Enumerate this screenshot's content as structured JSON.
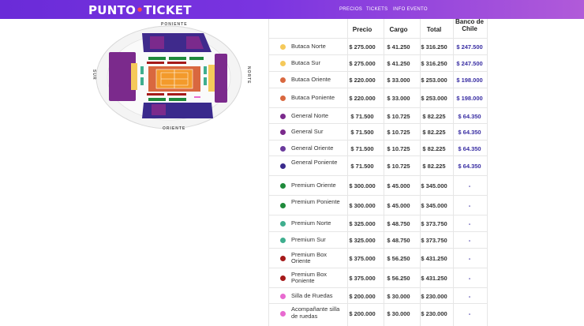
{
  "header": {
    "logo_text": "PUNTO",
    "logo_mark": "•",
    "logo_text2": "TICKET",
    "nav": [
      "PRECIOS",
      "TICKETS",
      "INFO EVENTO"
    ]
  },
  "map": {
    "label_top": "PONIENTE",
    "label_bottom": "ORIENTE",
    "label_left": "SUR",
    "label_right": "NORTE"
  },
  "table": {
    "columns": [
      "Precio",
      "Cargo",
      "Total",
      "Banco de Chile"
    ],
    "rows": [
      {
        "name": "Butaca Norte",
        "color": "#f5c95a",
        "precio": "$ 275.000",
        "cargo": "$ 41.250",
        "total": "$ 316.250",
        "banco": "$ 247.500"
      },
      {
        "name": "Butaca Sur",
        "color": "#f5c95a",
        "precio": "$ 275.000",
        "cargo": "$ 41.250",
        "total": "$ 316.250",
        "banco": "$ 247.500"
      },
      {
        "name": "Butaca Oriente",
        "color": "#d9683f",
        "precio": "$ 220.000",
        "cargo": "$ 33.000",
        "total": "$ 253.000",
        "banco": "$ 198.000"
      },
      {
        "name": "Butaca Poniente",
        "color": "#d9683f",
        "precio": "$ 220.000",
        "cargo": "$ 33.000",
        "total": "$ 253.000",
        "banco": "$ 198.000"
      },
      {
        "name": "General Norte",
        "color": "#7b2a8c",
        "precio": "$ 71.500",
        "cargo": "$ 10.725",
        "total": "$ 82.225",
        "banco": "$ 64.350"
      },
      {
        "name": "General Sur",
        "color": "#7b2a8c",
        "precio": "$ 71.500",
        "cargo": "$ 10.725",
        "total": "$ 82.225",
        "banco": "$ 64.350"
      },
      {
        "name": "General Oriente",
        "color": "#6a3a9c",
        "precio": "$ 71.500",
        "cargo": "$ 10.725",
        "total": "$ 82.225",
        "banco": "$ 64.350"
      },
      {
        "name": "General Poniente",
        "color": "#3a2a8c",
        "precio": "$ 71.500",
        "cargo": "$ 10.725",
        "total": "$ 82.225",
        "banco": "$ 64.350"
      },
      {
        "name": "Premium Oriente",
        "color": "#1f8a3b",
        "precio": "$ 300.000",
        "cargo": "$ 45.000",
        "total": "$ 345.000",
        "banco": "-"
      },
      {
        "name": "Premium Poniente",
        "color": "#1f8a3b",
        "precio": "$ 300.000",
        "cargo": "$ 45.000",
        "total": "$ 345.000",
        "banco": "-"
      },
      {
        "name": "Premium Norte",
        "color": "#3fae8e",
        "precio": "$ 325.000",
        "cargo": "$ 48.750",
        "total": "$ 373.750",
        "banco": "-"
      },
      {
        "name": "Premium Sur",
        "color": "#3fae8e",
        "precio": "$ 325.000",
        "cargo": "$ 48.750",
        "total": "$ 373.750",
        "banco": "-"
      },
      {
        "name": "Premium Box Oriente",
        "color": "#a51a1a",
        "precio": "$ 375.000",
        "cargo": "$ 56.250",
        "total": "$ 431.250",
        "banco": "-"
      },
      {
        "name": "Premium Box Poniente",
        "color": "#a51a1a",
        "precio": "$ 375.000",
        "cargo": "$ 56.250",
        "total": "$ 431.250",
        "banco": "-"
      },
      {
        "name": "Silla de Ruedas",
        "color": "#e86ad0",
        "precio": "$ 200.000",
        "cargo": "$ 30.000",
        "total": "$ 230.000",
        "banco": "-"
      },
      {
        "name": "Acompañante silla de ruedas",
        "color": "#e86ad0",
        "precio": "$ 200.000",
        "cargo": "$ 30.000",
        "total": "$ 230.000",
        "banco": "-"
      }
    ]
  }
}
